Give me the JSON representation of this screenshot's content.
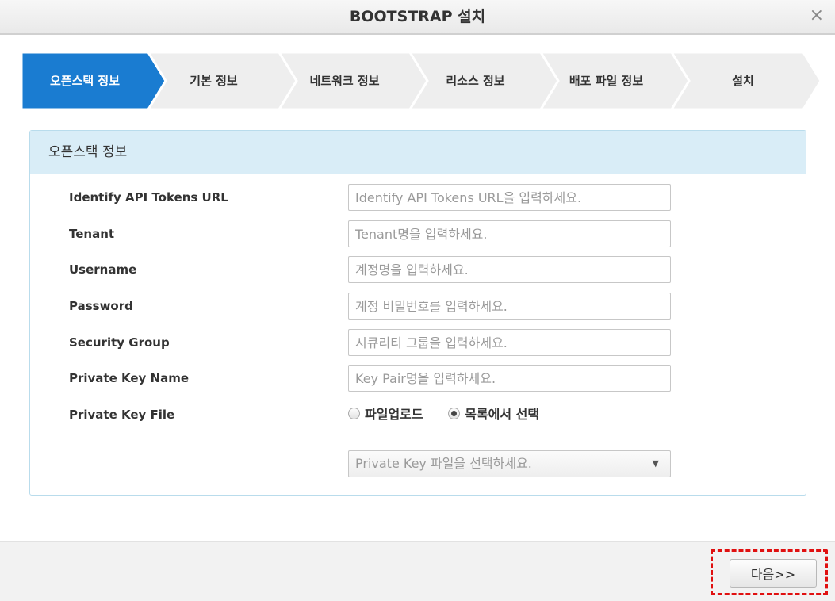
{
  "window": {
    "title": "BOOTSTRAP 설치",
    "close_glyph": "×"
  },
  "steps": [
    {
      "label": "오픈스택 정보",
      "active": true
    },
    {
      "label": "기본 정보",
      "active": false
    },
    {
      "label": "네트워크 정보",
      "active": false
    },
    {
      "label": "리소스 정보",
      "active": false
    },
    {
      "label": "배포 파일 정보",
      "active": false
    },
    {
      "label": "설치",
      "active": false
    }
  ],
  "colors": {
    "active_step": "#1a7cd1",
    "inactive_step": "#eeeeee",
    "panel_header": "#d9edf7",
    "highlight": "#e01010"
  },
  "panel": {
    "title": "오픈스택 정보",
    "fields": [
      {
        "label": "Identify API Tokens URL",
        "placeholder": "Identify API Tokens URL을 입력하세요.",
        "value": ""
      },
      {
        "label": "Tenant",
        "placeholder": "Tenant명을 입력하세요.",
        "value": ""
      },
      {
        "label": "Username",
        "placeholder": "계정명을 입력하세요.",
        "value": ""
      },
      {
        "label": "Password",
        "placeholder": "계정 비밀번호를 입력하세요.",
        "value": ""
      },
      {
        "label": "Security Group",
        "placeholder": "시큐리티 그룹을 입력하세요.",
        "value": ""
      },
      {
        "label": "Private Key Name",
        "placeholder": "Key Pair명을 입력하세요.",
        "value": ""
      }
    ],
    "key_file": {
      "label": "Private Key File",
      "options": [
        {
          "label": "파일업로드",
          "checked": false
        },
        {
          "label": "목록에서 선택",
          "checked": true
        }
      ],
      "select_placeholder": "Private Key 파일을 선택하세요.",
      "caret_glyph": "▼"
    }
  },
  "footer": {
    "next_label": "다음>>"
  }
}
